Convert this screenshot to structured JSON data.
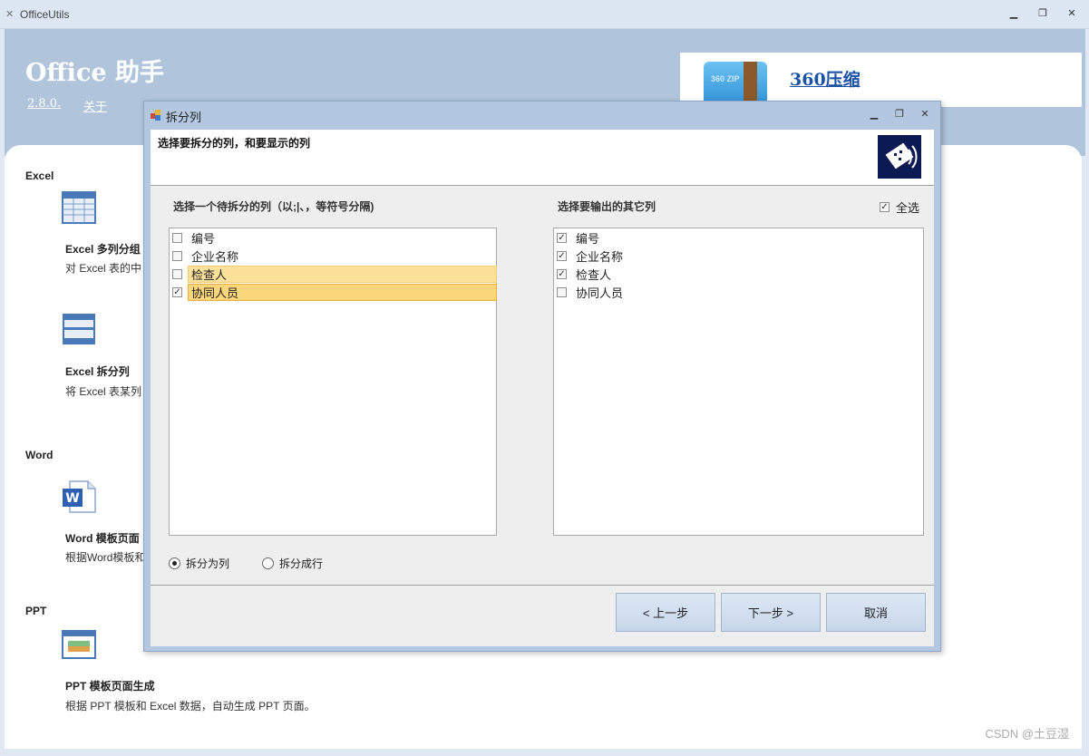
{
  "window": {
    "title": "OfficeUtils",
    "controls": [
      "minimize",
      "restore",
      "close"
    ]
  },
  "banner": {
    "title": "Office 助手",
    "version": "2.8.0.",
    "about": "关于",
    "ad_link": "360压缩",
    "ad_logo_text": "360 ZIP"
  },
  "sections": {
    "excel": "Excel",
    "word": "Word",
    "ppt": "PPT"
  },
  "features": {
    "excel_group": {
      "title": "Excel 多列分组",
      "desc": "对 Excel 表的中"
    },
    "excel_split": {
      "title": "Excel 拆分列",
      "desc": "将 Excel 表某列"
    },
    "word_template": {
      "title": "Word 模板页面",
      "desc": "根据Word模板和"
    },
    "ppt_template": {
      "title": "PPT 模板页面生成",
      "desc": "根据 PPT 模板和 Excel 数据，自动生成 PPT 页面。"
    }
  },
  "watermark": "CSDN @土豆湿",
  "dialog": {
    "title": "拆分列",
    "header_text": "选择要拆分的列，和要显示的列",
    "left_label": "选择一个待拆分的列（以;|、，等符号分隔)",
    "right_label": "选择要输出的其它列",
    "select_all": "全选",
    "select_all_checked": true,
    "left_items": [
      {
        "label": "编号",
        "checked": false
      },
      {
        "label": "企业名称",
        "checked": false
      },
      {
        "label": "检查人",
        "checked": false
      },
      {
        "label": "协同人员",
        "checked": true
      }
    ],
    "right_items": [
      {
        "label": "编号",
        "checked": true
      },
      {
        "label": "企业名称",
        "checked": true
      },
      {
        "label": "检查人",
        "checked": true
      },
      {
        "label": "协同人员",
        "checked": false
      }
    ],
    "radio_split_col": "拆分为列",
    "radio_split_row": "拆分成行",
    "radio_selected": "拆分为列",
    "buttons": {
      "prev": "< 上一步",
      "next": "下一步 >",
      "cancel": "取消"
    }
  }
}
